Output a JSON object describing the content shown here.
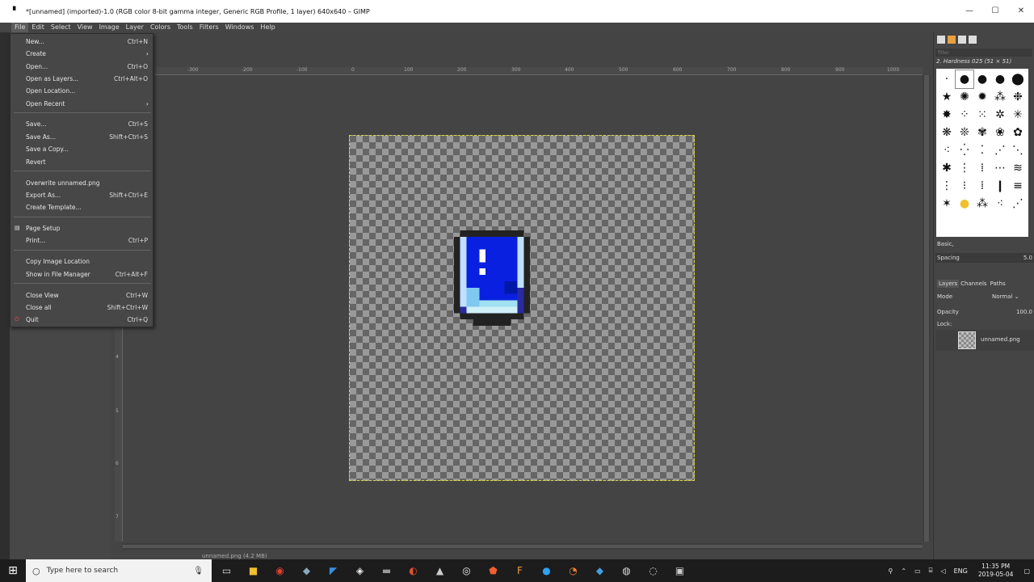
{
  "window": {
    "title": "*[unnamed] (imported)-1.0 (RGB color 8-bit gamma integer, Generic RGB Profile, 1 layer) 640x640 – GIMP",
    "minimize": "—",
    "maximize": "☐",
    "close": "✕"
  },
  "menubar": {
    "items": [
      "File",
      "Edit",
      "Select",
      "View",
      "Image",
      "Layer",
      "Colors",
      "Tools",
      "Filters",
      "Windows",
      "Help"
    ]
  },
  "file_menu": {
    "items": [
      {
        "label": "New...",
        "accel": "Ctrl+N"
      },
      {
        "label": "Create",
        "accel": ""
      },
      {
        "label": "Open...",
        "accel": "Ctrl+O"
      },
      {
        "label": "Open as Layers...",
        "accel": "Ctrl+Alt+O"
      },
      {
        "label": "Open Location...",
        "accel": ""
      },
      {
        "label": "Open Recent",
        "accel": ""
      },
      {
        "label": "Save...",
        "accel": "Ctrl+S"
      },
      {
        "label": "Save As...",
        "accel": "Shift+Ctrl+S"
      },
      {
        "label": "Save a Copy...",
        "accel": ""
      },
      {
        "label": "Revert",
        "accel": ""
      },
      {
        "label": "Overwrite unnamed.png",
        "accel": ""
      },
      {
        "label": "Export As...",
        "accel": "Shift+Ctrl+E"
      },
      {
        "label": "Create Template...",
        "accel": ""
      },
      {
        "label": "Page Setup",
        "accel": ""
      },
      {
        "label": "Print...",
        "accel": "Ctrl+P"
      },
      {
        "label": "Copy Image Location",
        "accel": ""
      },
      {
        "label": "Show in File Manager",
        "accel": "Ctrl+Alt+F"
      },
      {
        "label": "Close View",
        "accel": "Ctrl+W"
      },
      {
        "label": "Close all",
        "accel": "Shift+Ctrl+W"
      },
      {
        "label": "Quit",
        "accel": "Ctrl+Q"
      }
    ]
  },
  "ruler": {
    "h_labels": [
      "-300",
      "-200",
      "-100",
      "0",
      "100",
      "200",
      "300",
      "400",
      "500",
      "600",
      "700",
      "800",
      "900",
      "1000"
    ],
    "v_labels": [
      "4",
      "5",
      "6",
      "7"
    ]
  },
  "statusbar": {
    "text": "unnamed.png (4.2 MB)"
  },
  "brushes": {
    "filter_placeholder": "filter",
    "current": "2. Hardness 025 (51 × 51)",
    "tag": "Basic,",
    "spacing_label": "Spacing",
    "spacing_value": "5.0"
  },
  "layers": {
    "tabs": [
      "Layers",
      "Channels",
      "Paths"
    ],
    "mode_label": "Mode",
    "mode_value": "Normal",
    "opacity_label": "Opacity",
    "opacity_value": "100.0",
    "lock_label": "Lock:",
    "layer_name": "unnamed.png"
  },
  "taskbar": {
    "search_placeholder": "Type here to search",
    "lang": "ENG",
    "time": "11:35 PM",
    "date": "2019-05-04"
  }
}
